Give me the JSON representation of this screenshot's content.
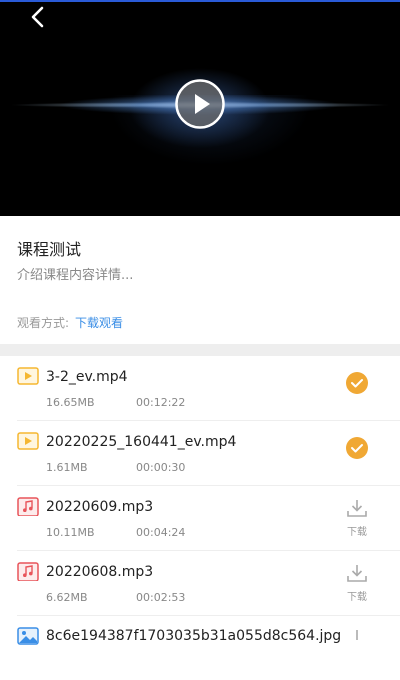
{
  "player": {
    "accent": "#2a5bd7"
  },
  "course": {
    "title": "课程测试",
    "description": "介绍课程内容详情...",
    "watch_mode_label": "观看方式:",
    "watch_mode_value": "下载观看"
  },
  "files": [
    {
      "name": "3-2_ev.mp4",
      "size": "16.65MB",
      "duration": "00:12:22",
      "type": "video-icon",
      "status": "downloaded"
    },
    {
      "name": "20220225_160441_ev.mp4",
      "size": "1.61MB",
      "duration": "00:00:30",
      "type": "video-icon",
      "status": "downloaded"
    },
    {
      "name": "20220609.mp3",
      "size": "10.11MB",
      "duration": "00:04:24",
      "type": "audio-icon",
      "status": "download",
      "action_label": "下载"
    },
    {
      "name": "20220608.mp3",
      "size": "6.62MB",
      "duration": "00:02:53",
      "type": "audio-icon",
      "status": "download",
      "action_label": "下载"
    },
    {
      "name": "8c6e194387f1703035b31a055d8c564.jpg",
      "size": "",
      "duration": "",
      "type": "image-icon",
      "status": "download"
    }
  ],
  "colors": {
    "video_icon": "#f5b731",
    "audio_icon": "#e8545a",
    "image_icon": "#3a8ee6",
    "downloaded": "#f0a834",
    "link": "#3a8ee6"
  }
}
